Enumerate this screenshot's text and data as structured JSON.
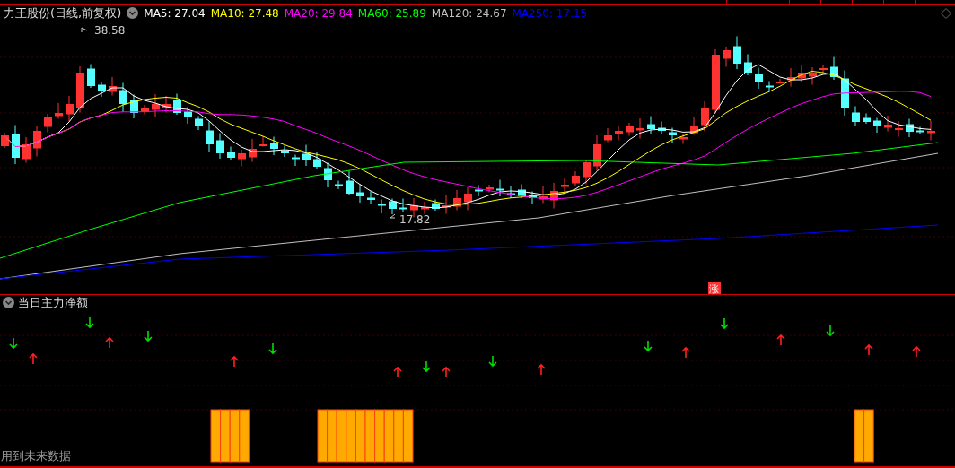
{
  "chart_header": {
    "title": "力王股份(日线,前复权)",
    "ma_legend": [
      {
        "label": "MA5: 27.04",
        "color": "#ffffff"
      },
      {
        "label": "MA10: 27.48",
        "color": "#ffff00"
      },
      {
        "label": "MA20: 29.84",
        "color": "#ff00ff"
      },
      {
        "label": "MA60: 25.89",
        "color": "#00ff00"
      },
      {
        "label": "MA120: 24.67",
        "color": "#c0c0c0"
      },
      {
        "label": "MA250: 17.15",
        "color": "#0000ff"
      }
    ]
  },
  "price_chart": {
    "high_label": "38.58",
    "low_label": "17.82",
    "marker": "涨"
  },
  "indicator": {
    "title": "当日主力净额",
    "note": "用到未来数据"
  }
}
